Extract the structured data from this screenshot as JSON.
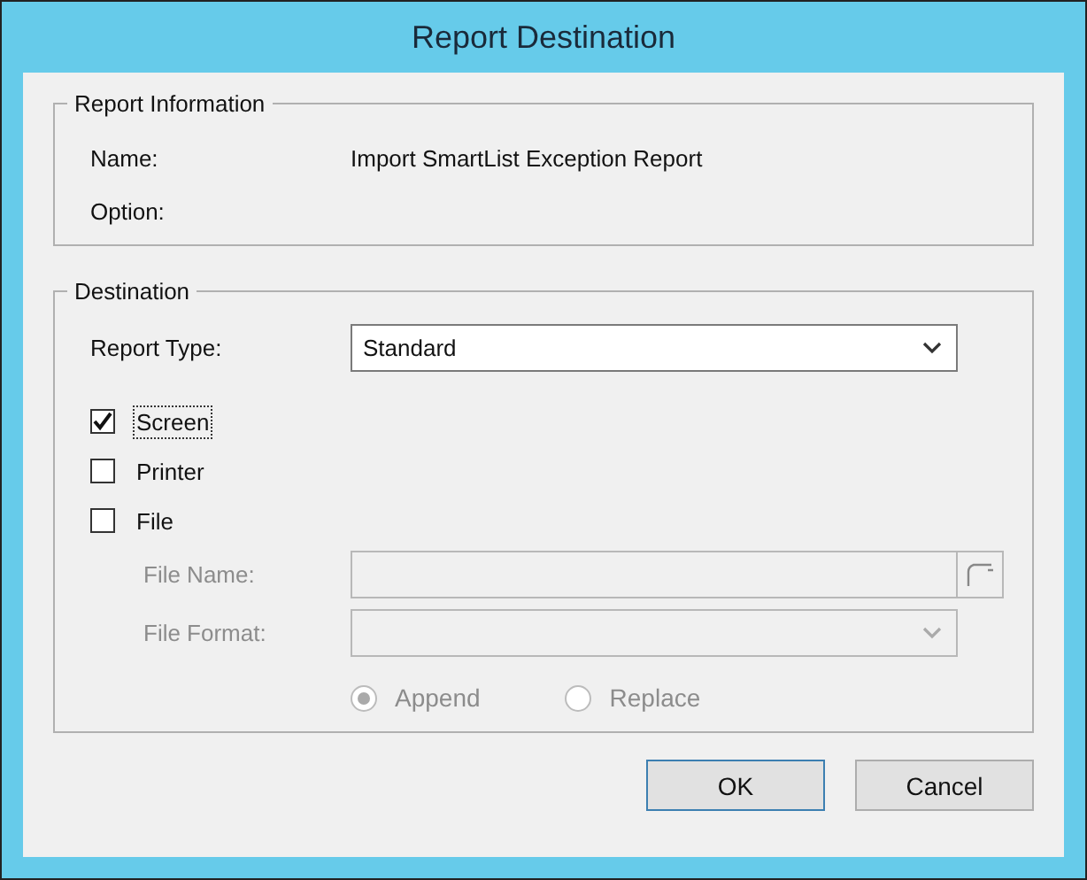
{
  "window": {
    "title": "Report Destination"
  },
  "report_information": {
    "title": "Report Information",
    "fields": [
      {
        "label": "Name:",
        "value": "Import SmartList Exception Report"
      },
      {
        "label": "Option:"
      }
    ]
  },
  "destination": {
    "title": "Destination",
    "report_type": {
      "label": "Report Type:",
      "value": "Standard"
    },
    "outputs": [
      {
        "label": "Screen",
        "checked": true,
        "focused": true
      },
      {
        "label": "Printer",
        "checked": false,
        "focused": false
      },
      {
        "label": "File",
        "checked": false,
        "focused": false
      }
    ],
    "file_name": {
      "label": "File Name:",
      "disabled": true
    },
    "file_format": {
      "label": "File Format:",
      "disabled": true
    },
    "write_modes": [
      {
        "label": "Append",
        "selected": true,
        "disabled": true
      },
      {
        "label": "Replace",
        "selected": false,
        "disabled": true
      }
    ]
  },
  "buttons": [
    {
      "label": "OK",
      "default": true
    },
    {
      "label": "Cancel",
      "default": false
    }
  ]
}
